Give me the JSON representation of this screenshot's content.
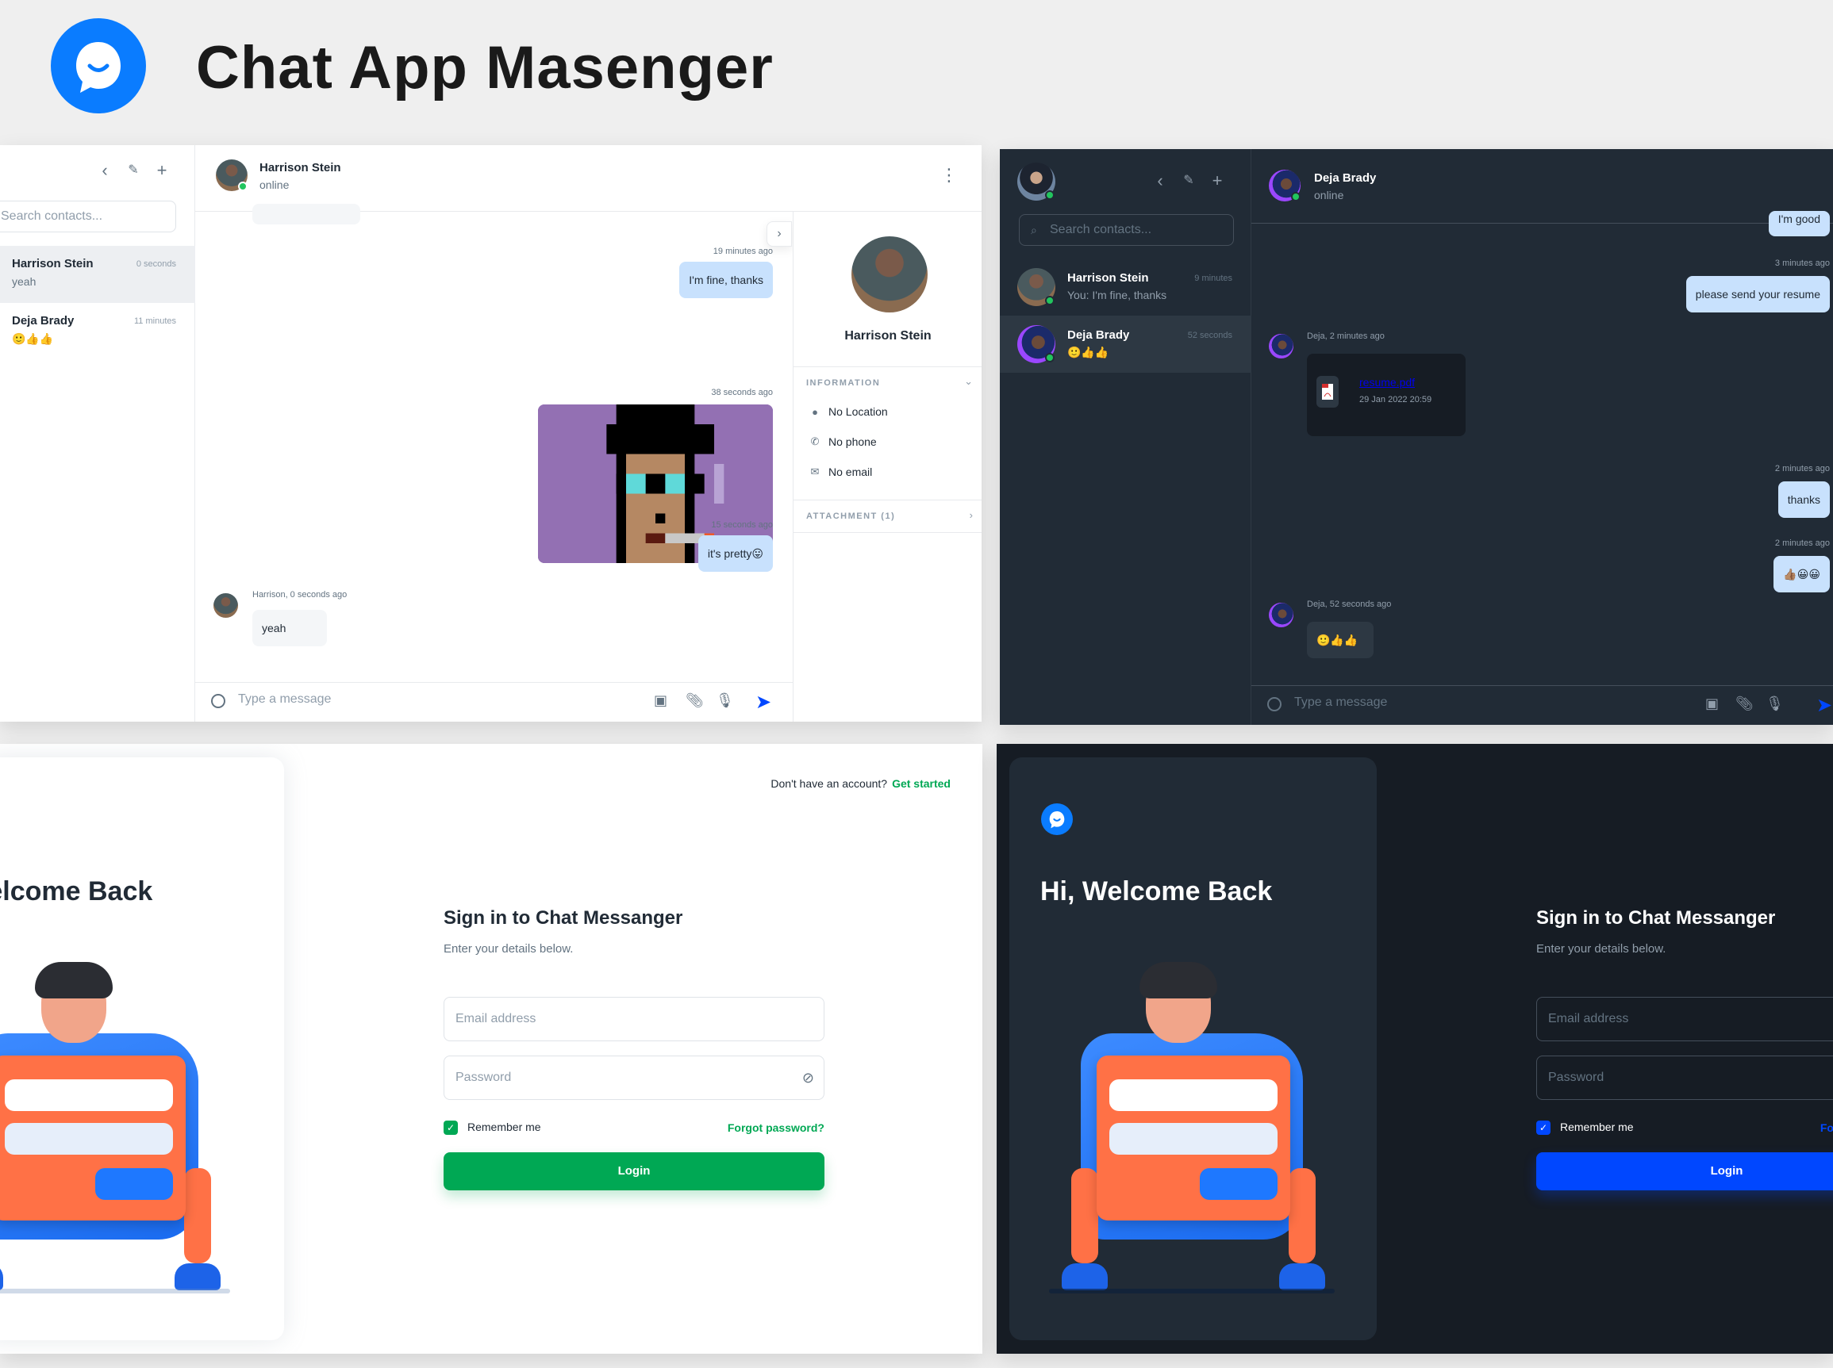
{
  "header": {
    "title": "Chat App Masenger",
    "logo_icon": "chat-bubble-smile-icon",
    "brand_color": "#0a7cff"
  },
  "light_chat": {
    "toolbar_icons": [
      "chevron-left-icon",
      "pencil-icon",
      "plus-icon"
    ],
    "search_placeholder": "Search contacts...",
    "contacts": [
      {
        "name": "Harrison Stein",
        "preview": "yeah",
        "time": "0 seconds",
        "active": true
      },
      {
        "name": "Deja Brady",
        "preview": "🙂👍👍",
        "time": "11 minutes",
        "active": false
      }
    ],
    "conversation": {
      "name": "Harrison Stein",
      "status": "online"
    },
    "messages": [
      {
        "direction": "in",
        "text": "",
        "partial": true
      },
      {
        "direction": "out",
        "time": "19 minutes ago",
        "text": "I'm fine, thanks"
      },
      {
        "direction": "out",
        "time": "38 seconds ago",
        "type": "image",
        "text": "pixel-art-punk-image"
      },
      {
        "direction": "out",
        "time": "15 seconds ago",
        "text": "it's pretty😛"
      },
      {
        "direction": "in",
        "meta": "Harrison, 0 seconds ago",
        "text": "yeah"
      }
    ],
    "info_panel": {
      "name": "Harrison Stein",
      "information_title": "INFORMATION",
      "rows": [
        {
          "icon": "location-pin-icon",
          "text": "No Location"
        },
        {
          "icon": "phone-icon",
          "text": "No phone"
        },
        {
          "icon": "mail-icon",
          "text": "No email"
        }
      ],
      "attachment_title": "ATTACHMENT (1)"
    },
    "composer": {
      "placeholder": "Type a message",
      "icons": [
        "add-image-icon",
        "paperclip-icon",
        "microphone-icon"
      ],
      "send_icon": "send-icon"
    },
    "accent": "#c8e1fd"
  },
  "dark_chat": {
    "toolbar_icons": [
      "chevron-left-icon",
      "pencil-icon",
      "plus-icon"
    ],
    "search_placeholder": "Search contacts...",
    "contacts": [
      {
        "name": "Harrison Stein",
        "preview": "You: I'm fine, thanks",
        "time": "9 minutes",
        "active": false
      },
      {
        "name": "Deja Brady",
        "preview": "🙂👍👍",
        "time": "52 seconds",
        "active": true
      }
    ],
    "conversation": {
      "name": "Deja Brady",
      "status": "online"
    },
    "messages": [
      {
        "direction": "out",
        "text": "I'm good",
        "partial": true
      },
      {
        "direction": "out",
        "time": "3 minutes ago",
        "text": "please send your resume"
      },
      {
        "direction": "in",
        "meta": "Deja, 2 minutes ago",
        "type": "file",
        "file_name": "resume.pdf",
        "file_date": "29 Jan 2022 20:59"
      },
      {
        "direction": "out",
        "time": "2 minutes ago",
        "text": "thanks"
      },
      {
        "direction": "out",
        "time": "2 minutes ago",
        "text": "👍🏽😀😀"
      },
      {
        "direction": "in",
        "meta": "Deja, 52 seconds ago",
        "text": "🙂👍👍"
      }
    ],
    "composer": {
      "placeholder": "Type a message",
      "icons": [
        "add-image-icon",
        "paperclip-icon",
        "microphone-icon"
      ],
      "send_icon": "send-icon"
    }
  },
  "light_login": {
    "welcome": "Hi, Welcome Back",
    "signup_prompt": "Don't have an account?",
    "signup_link": "Get started",
    "form": {
      "title": "Sign in to Chat Messanger",
      "subtitle": "Enter your details below.",
      "email_placeholder": "Email address",
      "password_placeholder": "Password",
      "remember_label": "Remember me",
      "remember_checked": true,
      "forgot_label": "Forgot password?",
      "login_label": "Login"
    },
    "accent": "#00a854"
  },
  "dark_login": {
    "welcome": "Hi, Welcome Back",
    "form": {
      "title": "Sign in to Chat Messanger",
      "subtitle": "Enter your details below.",
      "email_placeholder": "Email address",
      "password_placeholder": "Password",
      "remember_label": "Remember me",
      "remember_checked": true,
      "forgot_label": "Forgot password?",
      "login_label": "Login"
    },
    "accent": "#0047ff"
  }
}
